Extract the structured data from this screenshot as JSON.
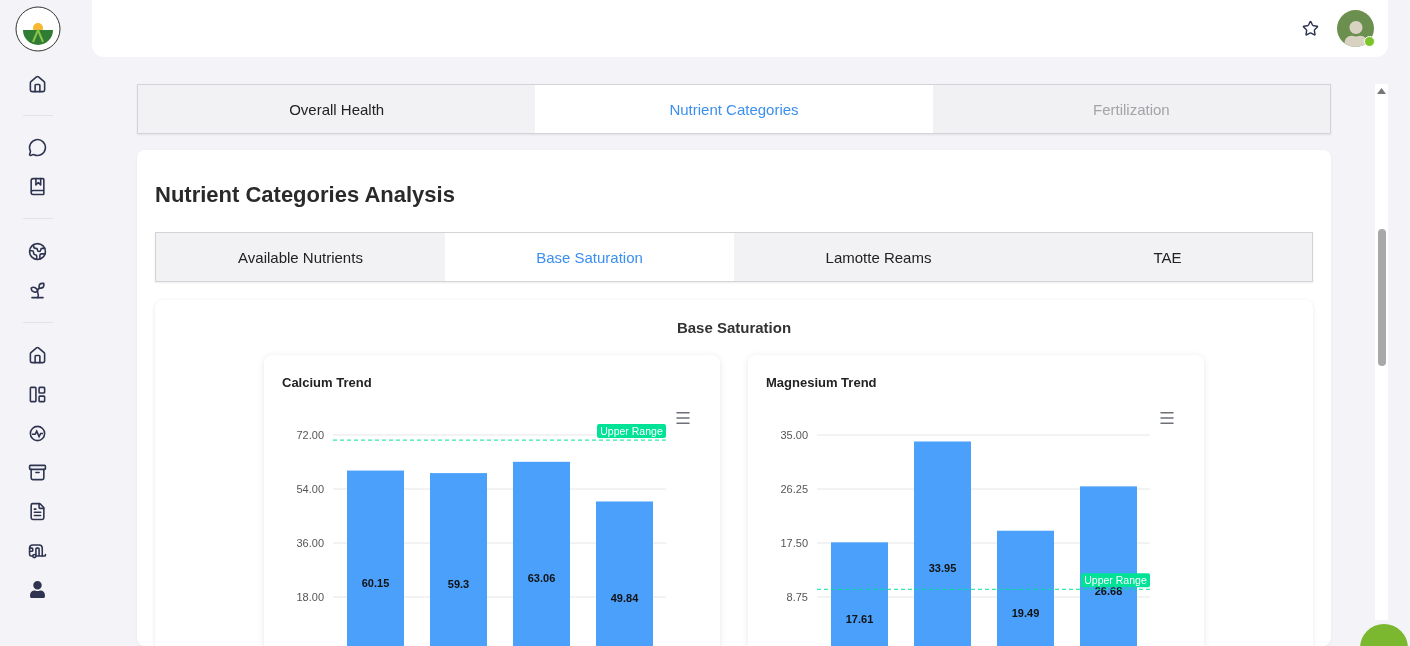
{
  "header": {
    "avatar": {
      "online": true
    }
  },
  "tabs": [
    {
      "label": "Overall Health",
      "selected": false,
      "disabled": false
    },
    {
      "label": "Nutrient Categories",
      "selected": true,
      "disabled": false
    },
    {
      "label": "Fertilization",
      "selected": false,
      "disabled": true
    }
  ],
  "section": {
    "title": "Nutrient Categories Analysis",
    "tabs": [
      {
        "label": "Available Nutrients",
        "selected": false
      },
      {
        "label": "Base Saturation",
        "selected": true
      },
      {
        "label": "Lamotte Reams",
        "selected": false
      },
      {
        "label": "TAE",
        "selected": false
      }
    ],
    "panel": {
      "title": "Base Saturation",
      "charts": [
        {
          "chart_data": {
            "type": "bar",
            "title": "Calcium Trend",
            "values": [
              60.15,
              59.3,
              63.06,
              49.84
            ],
            "ylim": [
              0,
              72
            ],
            "yticks": [
              {
                "value": 18,
                "label": "18.00"
              },
              {
                "value": 36,
                "label": "36.00"
              },
              {
                "value": 54,
                "label": "54.00"
              },
              {
                "value": 72,
                "label": "72.00"
              }
            ],
            "data_labels": true,
            "grid": true,
            "ref_lines": [
              {
                "axis": "y",
                "value": 70.3,
                "label": "Upper Range",
                "color": "#00e396"
              }
            ]
          }
        },
        {
          "chart_data": {
            "type": "bar",
            "title": "Magnesium Trend",
            "values": [
              17.61,
              33.95,
              19.49,
              26.68
            ],
            "ylim": [
              0,
              35
            ],
            "yticks": [
              {
                "value": 8.75,
                "label": "8.75"
              },
              {
                "value": 17.5,
                "label": "17.50"
              },
              {
                "value": 26.25,
                "label": "26.25"
              },
              {
                "value": 35,
                "label": "35.00"
              }
            ],
            "data_labels": true,
            "grid": true,
            "ref_lines": [
              {
                "axis": "y",
                "value": 10,
                "label": "Upper Range",
                "color": "#00e396"
              }
            ]
          }
        }
      ]
    }
  }
}
